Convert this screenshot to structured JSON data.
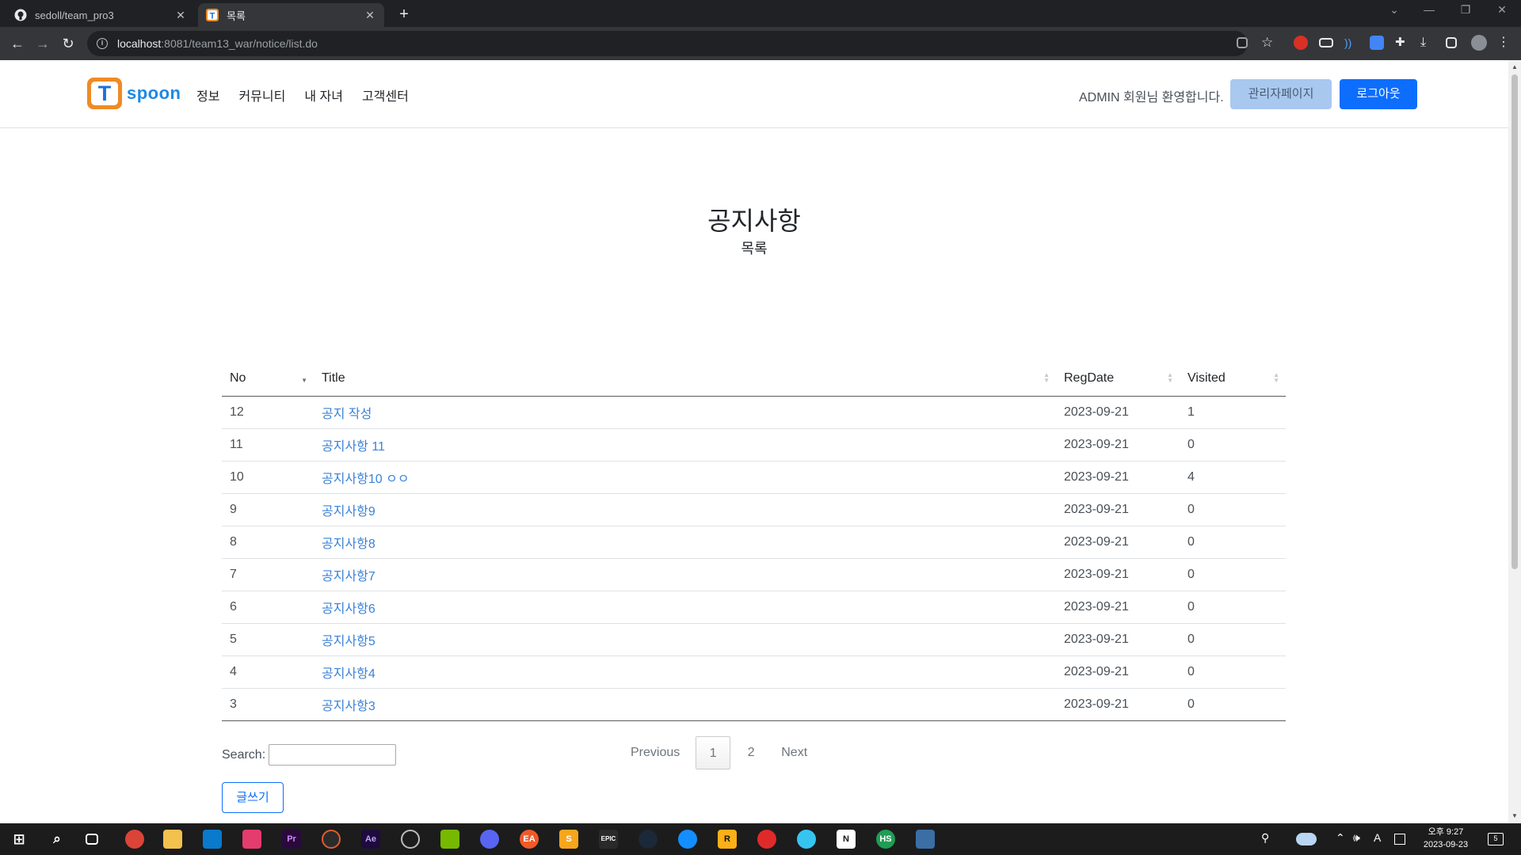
{
  "browser": {
    "tabs": [
      {
        "title": "sedoll/team_pro3",
        "icon": "github-icon",
        "active": false
      },
      {
        "title": "목록",
        "icon": "tspoon-favicon-icon",
        "active": true
      }
    ],
    "url_host": "localhost",
    "url_path": ":8081/team13_war/notice/list.do"
  },
  "header": {
    "logo_letter": "T",
    "logo_word": "spoon",
    "nav": [
      "정보",
      "커뮤니티",
      "내 자녀",
      "고객센터"
    ],
    "welcome": "ADMIN 회원님 환영합니다.",
    "admin_button": "관리자페이지",
    "logout_button": "로그아웃"
  },
  "main": {
    "title": "공지사항",
    "subtitle": "목록",
    "columns": [
      "No",
      "Title",
      "RegDate",
      "Visited"
    ],
    "rows": [
      {
        "no": "12",
        "title": "공지 작성",
        "date": "2023-09-21",
        "visited": "1"
      },
      {
        "no": "11",
        "title": "공지사항 11",
        "date": "2023-09-21",
        "visited": "0"
      },
      {
        "no": "10",
        "title": "공지사항10 ㅇㅇ",
        "date": "2023-09-21",
        "visited": "4"
      },
      {
        "no": "9",
        "title": "공지사항9",
        "date": "2023-09-21",
        "visited": "0"
      },
      {
        "no": "8",
        "title": "공지사항8",
        "date": "2023-09-21",
        "visited": "0"
      },
      {
        "no": "7",
        "title": "공지사항7",
        "date": "2023-09-21",
        "visited": "0"
      },
      {
        "no": "6",
        "title": "공지사항6",
        "date": "2023-09-21",
        "visited": "0"
      },
      {
        "no": "5",
        "title": "공지사항5",
        "date": "2023-09-21",
        "visited": "0"
      },
      {
        "no": "4",
        "title": "공지사항4",
        "date": "2023-09-21",
        "visited": "0"
      },
      {
        "no": "3",
        "title": "공지사항3",
        "date": "2023-09-21",
        "visited": "0"
      }
    ],
    "search_label": "Search:",
    "search_value": "",
    "pagination": {
      "previous": "Previous",
      "pages": [
        "1",
        "2"
      ],
      "current": "1",
      "next": "Next"
    },
    "write_button": "글쓰기"
  },
  "taskbar": {
    "clock_time": "오후 9:27",
    "clock_date": "2023-09-23",
    "ime": "A",
    "notification_count": "5"
  },
  "colors": {
    "brand_blue": "#0d6efd",
    "link_blue": "#3b82d6",
    "logo_orange": "#f08a24"
  }
}
